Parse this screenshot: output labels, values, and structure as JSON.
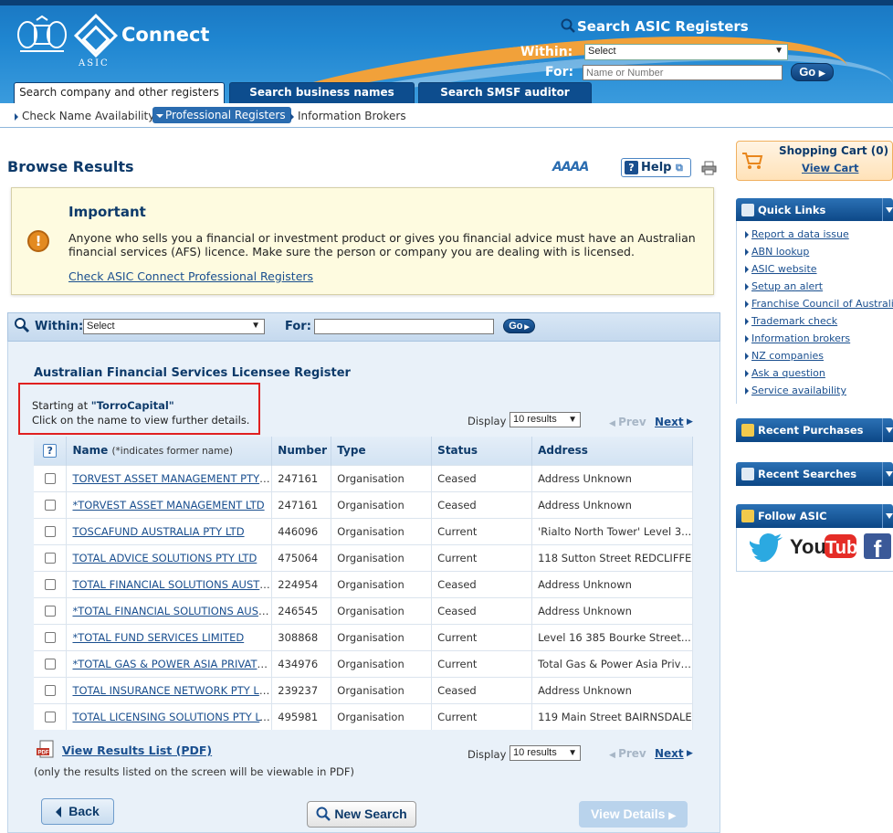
{
  "header": {
    "logo_text": "Connect",
    "org": "ASIC",
    "search_title": "Search ASIC Registers",
    "within_label": "Within:",
    "for_label": "For:",
    "within_value": "Select",
    "for_placeholder": "Name or Number",
    "go_label": "Go",
    "tabs": [
      {
        "label": "Search company and other registers",
        "active": true
      },
      {
        "label": "Search business names register",
        "active": false
      },
      {
        "label": "Search SMSF auditor register",
        "active": false
      }
    ]
  },
  "subnav": [
    {
      "label": "Check Name Availability",
      "active": false
    },
    {
      "label": "Professional Registers",
      "active": true
    },
    {
      "label": "Information Brokers",
      "active": false
    }
  ],
  "page": {
    "title": "Browse Results",
    "font_size_ctrl": "AAAA",
    "help_label": "Help"
  },
  "important": {
    "title": "Important",
    "text": "Anyone who sells you a financial or investment product or gives you financial advice must have an Australian financial services (AFS) licence. Make sure the person or company you are dealing with is licensed.",
    "link": "Check ASIC Connect Professional Registers"
  },
  "search_bar": {
    "within_label": "Within:",
    "within_value": "Select",
    "for_label": "For:",
    "go_label": "Go"
  },
  "register": {
    "title": "Australian Financial Services Licensee Register",
    "starting_prefix": "Starting at",
    "starting_value": "\"TorroCapital\"",
    "instruction": "Click on the name to view further details.",
    "display_label": "Display",
    "display_value": "10 results",
    "prev_label": "Prev",
    "next_label": "Next"
  },
  "table": {
    "help_symbol": "?",
    "columns": {
      "name": "Name",
      "name_note": "(*indicates former name)",
      "number": "Number",
      "type": "Type",
      "status": "Status",
      "address": "Address"
    },
    "rows": [
      {
        "name": "TORVEST ASSET MANAGEMENT PTY LTD",
        "number": "247161",
        "type": "Organisation",
        "status": "Ceased",
        "address": "Address Unknown"
      },
      {
        "name": "*TORVEST ASSET MANAGEMENT LTD",
        "number": "247161",
        "type": "Organisation",
        "status": "Ceased",
        "address": "Address Unknown"
      },
      {
        "name": "TOSCAFUND AUSTRALIA PTY LTD",
        "number": "446096",
        "type": "Organisation",
        "status": "Current",
        "address": "'Rialto North Tower' Level 3..."
      },
      {
        "name": "TOTAL ADVICE SOLUTIONS PTY LTD",
        "number": "475064",
        "type": "Organisation",
        "status": "Current",
        "address": "118 Sutton Street REDCLIFFE"
      },
      {
        "name": "TOTAL FINANCIAL SOLUTIONS AUSTRALIA",
        "number": "224954",
        "type": "Organisation",
        "status": "Ceased",
        "address": "Address Unknown"
      },
      {
        "name": "*TOTAL FINANCIAL SOLUTIONS AUSTRALIA",
        "number": "246545",
        "type": "Organisation",
        "status": "Ceased",
        "address": "Address Unknown"
      },
      {
        "name": "*TOTAL FUND SERVICES LIMITED",
        "number": "308868",
        "type": "Organisation",
        "status": "Current",
        "address": "Level 16 385 Bourke Street..."
      },
      {
        "name": "*TOTAL GAS & POWER ASIA PRIVATE LTD",
        "number": "434976",
        "type": "Organisation",
        "status": "Current",
        "address": "Total Gas & Power Asia Private"
      },
      {
        "name": "TOTAL INSURANCE NETWORK PTY LIMITED",
        "number": "239237",
        "type": "Organisation",
        "status": "Ceased",
        "address": "Address Unknown"
      },
      {
        "name": "TOTAL LICENSING SOLUTIONS PTY LTD",
        "number": "495981",
        "type": "Organisation",
        "status": "Current",
        "address": "119 Main Street BAIRNSDALE"
      }
    ]
  },
  "footer": {
    "pdf_link": "View Results List (PDF)",
    "pdf_note": "(only the results listed on the screen will be viewable in PDF)",
    "back_label": "Back",
    "new_search_label": "New Search",
    "view_details_label": "View Details"
  },
  "sidebar": {
    "cart_title": "Shopping Cart (0)",
    "cart_link": "View Cart",
    "quick_links_title": "Quick Links",
    "quick_links": [
      "Report a data issue",
      "ABN lookup",
      "ASIC website",
      "Setup an alert",
      "Franchise Council of Australia",
      "Trademark check",
      "Information brokers",
      "NZ companies",
      "Ask a question",
      "Service availability"
    ],
    "recent_purchases_title": "Recent Purchases",
    "recent_searches_title": "Recent Searches",
    "follow_title": "Follow ASIC"
  },
  "colors": {
    "header_blue": "#1f86d1",
    "dark_blue": "#0d3a6a",
    "link_blue": "#1a4f8f",
    "important_bg": "#fefbe0",
    "highlight_red": "#e02020"
  }
}
